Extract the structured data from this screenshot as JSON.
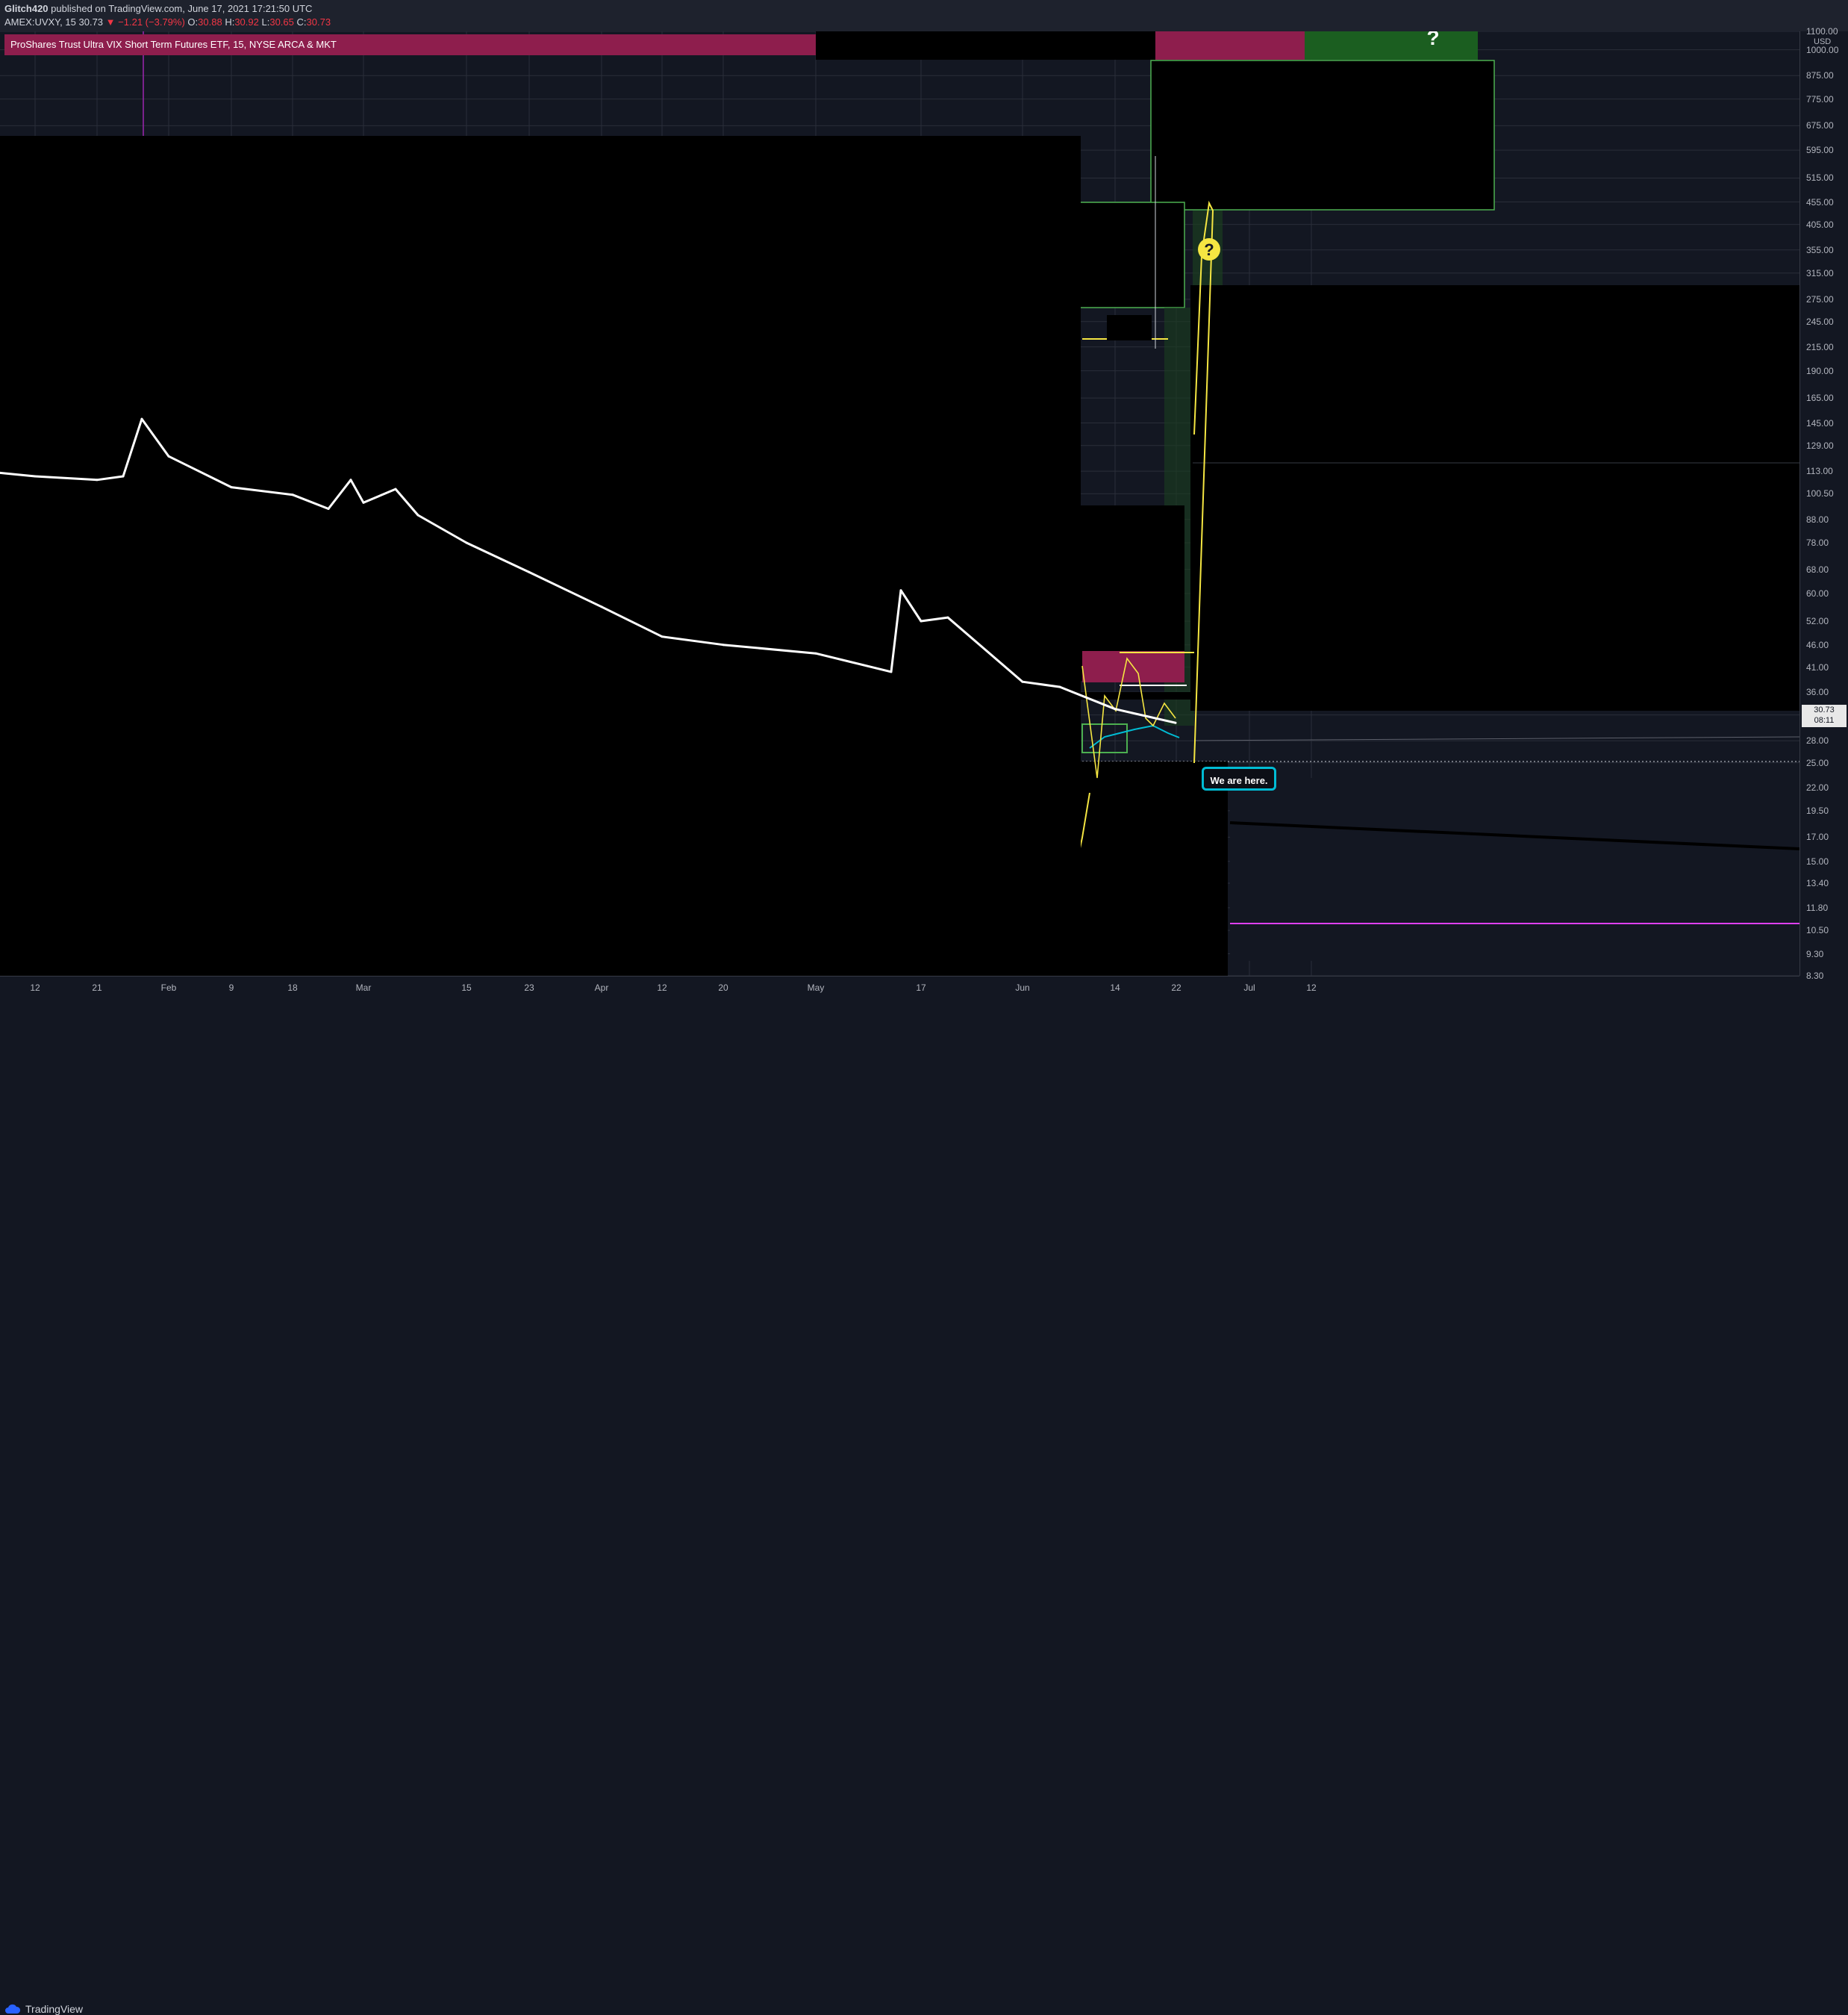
{
  "header": {
    "publisher": "Glitch420",
    "published_text": "published on TradingView.com, June 17, 2021 17:21:50 UTC",
    "symbol": "AMEX:UVXY, 15",
    "last": "30.73",
    "change": "−1.21 (−3.79%)",
    "open_label": "O:",
    "open": "30.88",
    "high_label": "H:",
    "high": "30.92",
    "low_label": "L:",
    "low": "30.65",
    "close_label": "C:",
    "close": "30.73"
  },
  "symbol_bar": {
    "text": "ProShares Trust Ultra VIX Short Term Futures ETF, 15, NYSE ARCA & MKT"
  },
  "price_axis": {
    "currency": "USD",
    "last_price": "30.73",
    "countdown": "08:11",
    "ticks": [
      "1100.00",
      "1000.00",
      "875.00",
      "775.00",
      "675.00",
      "595.00",
      "515.00",
      "455.00",
      "405.00",
      "355.00",
      "315.00",
      "275.00",
      "245.00",
      "215.00",
      "190.00",
      "165.00",
      "145.00",
      "129.00",
      "113.00",
      "100.50",
      "88.00",
      "78.00",
      "68.00",
      "60.00",
      "52.00",
      "46.00",
      "41.00",
      "36.00",
      "32.00",
      "28.00",
      "25.00",
      "22.00",
      "19.50",
      "17.00",
      "15.00",
      "13.40",
      "11.80",
      "10.50",
      "9.30",
      "8.30"
    ]
  },
  "time_axis": {
    "ticks": [
      "12",
      "21",
      "Feb",
      "9",
      "18",
      "Mar",
      "15",
      "23",
      "Apr",
      "12",
      "20",
      "May",
      "17",
      "Jun",
      "14",
      "22",
      "Jul",
      "12"
    ]
  },
  "annotations": {
    "callout": "We are here.",
    "question_mark_1": "?",
    "question_mark_2": "?"
  },
  "footer": {
    "brand": "TradingView"
  },
  "colors": {
    "background": "#131722",
    "price_line": "#ffffff",
    "indicator_yellow": "#f5e642",
    "indicator_cyan": "#00bcd4",
    "indicator_pink": "#e91e63",
    "zone_green": "#1b5e20",
    "zone_red": "#8e1e4d",
    "magenta_line": "#e040fb"
  },
  "chart_data": {
    "type": "line",
    "title": "ProShares Trust Ultra VIX Short Term Futures ETF, 15, NYSE ARCA & MKT",
    "xlabel": "",
    "ylabel": "USD",
    "y_scale": "log",
    "ylim": [
      8.3,
      1100
    ],
    "grid": true,
    "x": [
      "Jan 8",
      "Jan 12",
      "Jan 21",
      "Jan 26",
      "Jan 28",
      "Feb 1",
      "Feb 9",
      "Feb 18",
      "Feb 23",
      "Feb 25",
      "Mar 1",
      "Mar 4",
      "Mar 8",
      "Mar 15",
      "Mar 23",
      "Apr 1",
      "Apr 12",
      "Apr 20",
      "May 1",
      "May 12",
      "May 13",
      "May 17",
      "May 19",
      "Jun 1",
      "Jun 7",
      "Jun 14",
      "Jun 17"
    ],
    "series": [
      {
        "values": [
          112,
          110,
          108,
          110,
          148,
          122,
          104,
          100,
          93,
          108,
          96,
          103,
          90,
          78,
          67,
          56,
          48,
          46,
          44,
          40,
          61,
          52,
          53,
          38,
          37,
          33,
          30.73
        ]
      }
    ]
  }
}
